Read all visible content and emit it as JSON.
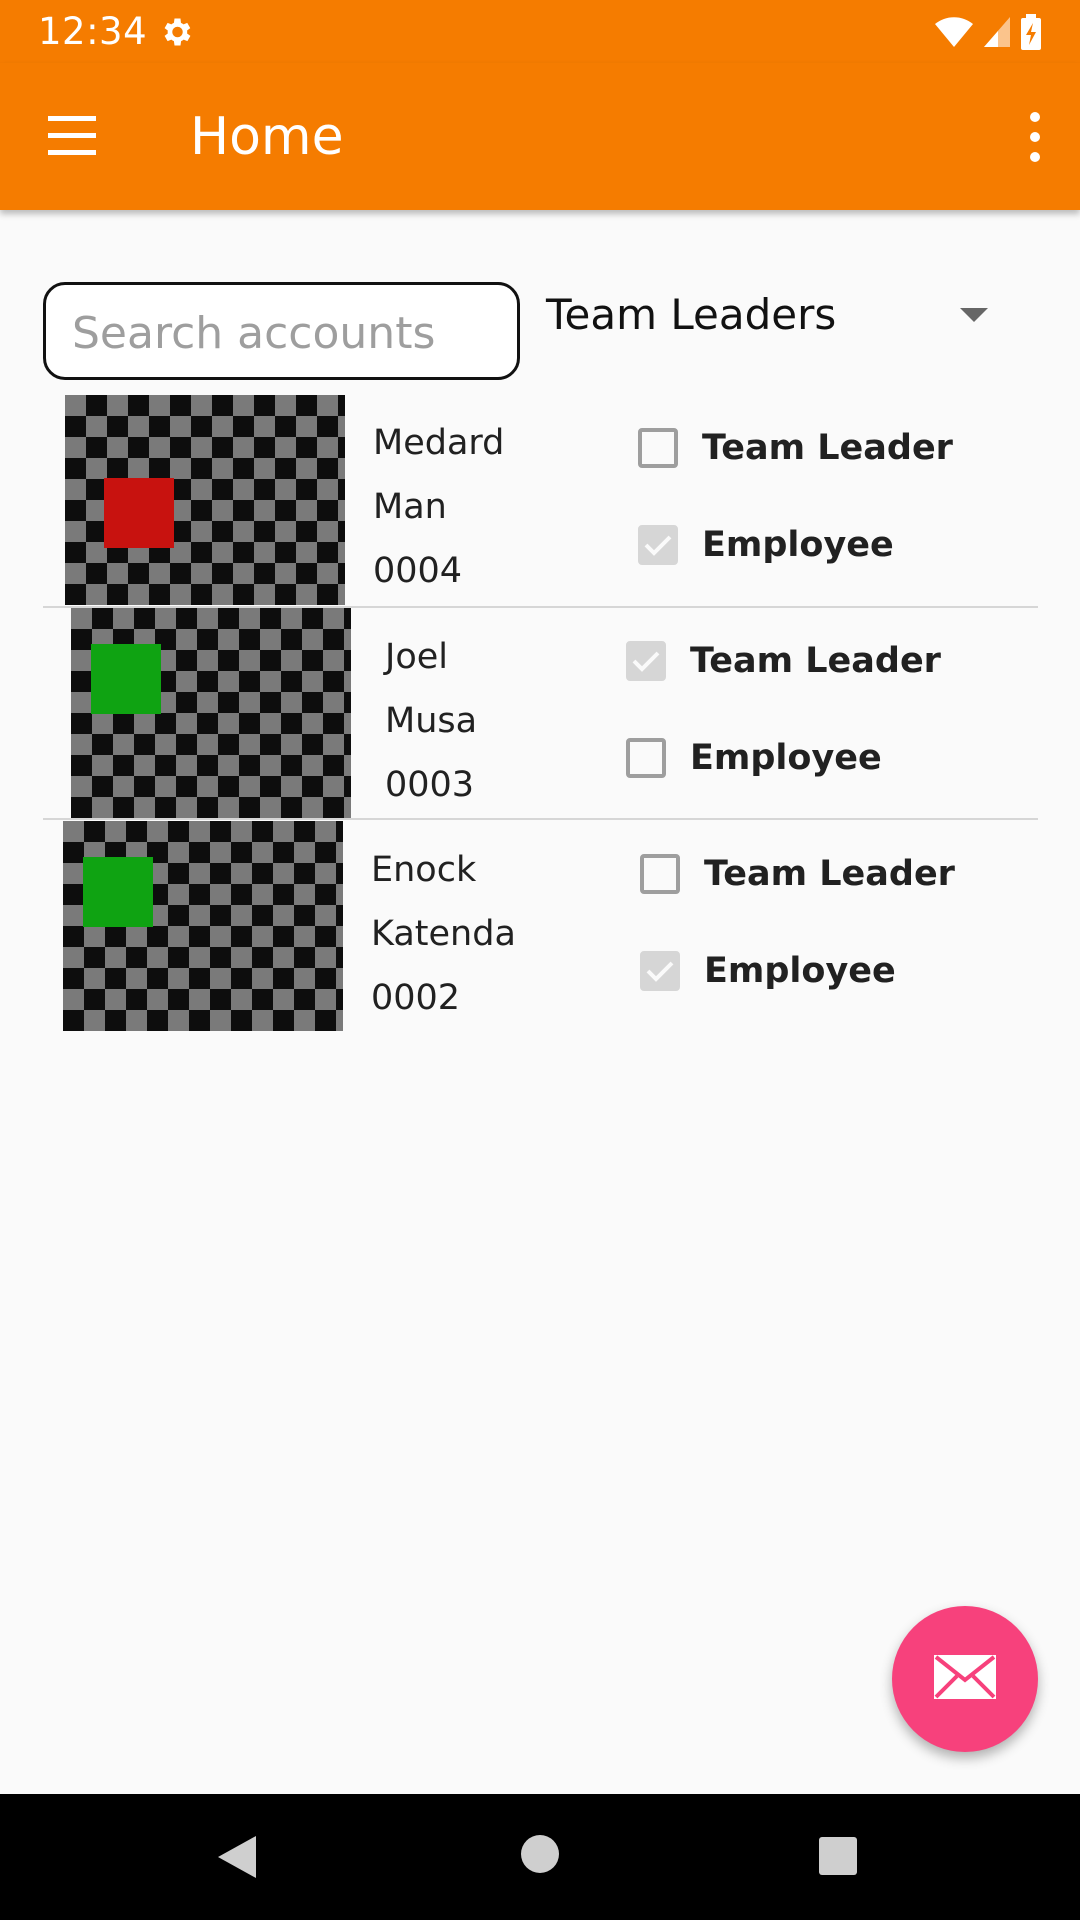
{
  "status_bar": {
    "time": "12:34",
    "icons": [
      "settings-gear-icon",
      "wifi-icon",
      "cell-signal-icon",
      "battery-charging-icon"
    ]
  },
  "app_bar": {
    "title": "Home",
    "menu_icon": "hamburger-menu-icon",
    "overflow_icon": "overflow-menu-icon",
    "background": "#f57c00"
  },
  "search": {
    "placeholder": "Search accounts",
    "value": ""
  },
  "filter": {
    "selected": "Team Leaders"
  },
  "accounts": [
    {
      "first_name": "Medard",
      "last_name": "Man",
      "id": "0004",
      "status_color": "#c8120f",
      "team_leader_label": "Team Leader",
      "team_leader_checked": false,
      "employee_label": "Employee",
      "employee_checked": true
    },
    {
      "first_name": "Joel",
      "last_name": "Musa",
      "id": "0003",
      "status_color": "#0fa312",
      "team_leader_label": "Team Leader",
      "team_leader_checked": true,
      "employee_label": "Employee",
      "employee_checked": false
    },
    {
      "first_name": "Enock",
      "last_name": "Katenda",
      "id": "0002",
      "status_color": "#0fa312",
      "team_leader_label": "Team Leader",
      "team_leader_checked": false,
      "employee_label": "Employee",
      "employee_checked": true
    }
  ],
  "fab": {
    "icon": "mail-icon",
    "color": "#f7417c"
  },
  "nav_bar": {
    "icons": [
      "back-icon",
      "home-icon",
      "recents-icon"
    ]
  }
}
